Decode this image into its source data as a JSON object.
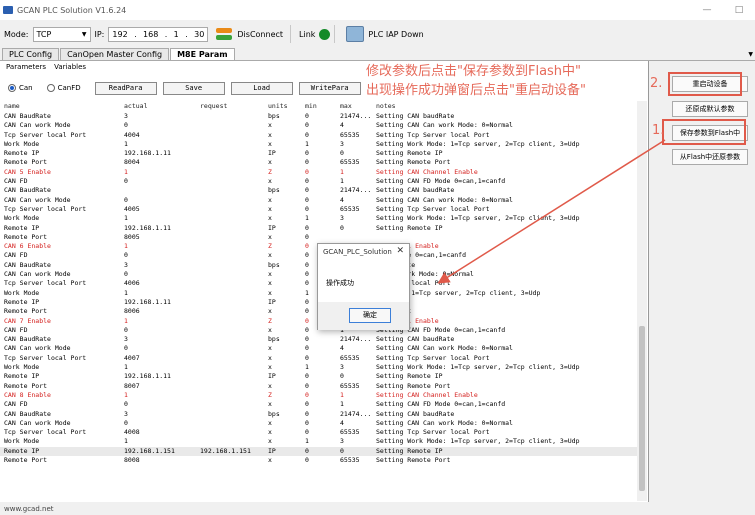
{
  "window": {
    "title": "GCAN PLC Solution V1.6.24",
    "minimize": "—",
    "maximize": "□"
  },
  "toolbar": {
    "mode_label": "Mode:",
    "mode_value": "TCP",
    "ip_label": "IP:",
    "ip": [
      "192",
      "168",
      "1",
      "30"
    ],
    "disconnect_label": "DisConnect",
    "link_label": "Link",
    "link_color": "#138a28",
    "iap_label": "PLC IAP Down"
  },
  "tabs": [
    "PLC Config",
    "CanOpen Master Config",
    "M8E Param"
  ],
  "subtabs": [
    "Parameters",
    "Variables"
  ],
  "controls": {
    "can": "Can",
    "canfd": "CanFD",
    "read": "ReadPara",
    "save": "Save",
    "load": "Load",
    "write": "WritePara"
  },
  "annotations": {
    "line1": "修改参数后点击\"保存参数到Flash中\"",
    "line2": "出现操作成功弹窗后点击\"重启动设备\"",
    "num2": "2.",
    "num1": "1.",
    "color": "#e05a4a"
  },
  "side_buttons": [
    "重启动设备",
    "还原成默认参数",
    "保存参数到Flash中",
    "从Flash中还原参数"
  ],
  "dialog": {
    "title": "GCAN_PLC_Solution",
    "close": "✕",
    "message": "操作成功",
    "ok": "确定"
  },
  "table": {
    "headers": [
      "name",
      "actual",
      "request",
      "units",
      "min",
      "max",
      "notes"
    ],
    "rows": [
      {
        "c": [
          "CAN BaudRate",
          "3",
          "",
          "bps",
          "0",
          "21474...",
          "Setting CAN baudRate"
        ]
      },
      {
        "c": [
          "CAN Can work Mode",
          "0",
          "",
          "x",
          "0",
          "4",
          "Setting CAN Can work Mode: 0=Normal"
        ]
      },
      {
        "c": [
          "Tcp Server local Port",
          "4004",
          "",
          "x",
          "0",
          "65535",
          "Setting Tcp Server local Port"
        ]
      },
      {
        "c": [
          "Work Mode",
          "1",
          "",
          "x",
          "1",
          "3",
          "Setting Work Mode: 1=Tcp server, 2=Tcp client, 3=Udp"
        ]
      },
      {
        "c": [
          "Remote IP",
          "192.168.1.11",
          "",
          "IP",
          "0",
          "0",
          "Setting Remote IP"
        ]
      },
      {
        "c": [
          "Remote Port",
          "8004",
          "",
          "x",
          "0",
          "65535",
          "Setting Remote Port"
        ]
      },
      {
        "c": [
          "CAN 5 Enable",
          "1",
          "",
          "Z",
          "0",
          "1",
          "Setting CAN Channel Enable"
        ],
        "red": true
      },
      {
        "c": [
          "CAN FD",
          "0",
          "",
          "x",
          "0",
          "1",
          "Setting CAN FD Mode 0=can,1=canfd"
        ]
      },
      {
        "c": [
          "CAN BaudRate",
          "",
          "",
          "bps",
          "0",
          "21474...",
          "Setting CAN baudRate"
        ]
      },
      {
        "c": [
          "CAN Can work Mode",
          "0",
          "",
          "x",
          "0",
          "4",
          "Setting CAN Can work Mode: 0=Normal"
        ]
      },
      {
        "c": [
          "Tcp Server local Port",
          "4005",
          "",
          "x",
          "0",
          "65535",
          "Setting Tcp Server local Port"
        ]
      },
      {
        "c": [
          "Work Mode",
          "1",
          "",
          "x",
          "1",
          "3",
          "Setting Work Mode: 1=Tcp server, 2=Tcp client, 3=Udp"
        ]
      },
      {
        "c": [
          "Remote IP",
          "192.168.1.11",
          "",
          "IP",
          "0",
          "0",
          "Setting Remote IP"
        ]
      },
      {
        "c": [
          "Remote Port",
          "8005",
          "",
          "x",
          "0",
          "",
          ""
        ]
      },
      {
        "c": [
          "CAN 6 Enable",
          "1",
          "",
          "Z",
          "0",
          "",
          "N Channel Enable"
        ],
        "red": true
      },
      {
        "c": [
          "CAN FD",
          "0",
          "",
          "x",
          "0",
          "",
          "N FD Mode 0=can,1=canfd"
        ]
      },
      {
        "c": [
          "CAN BaudRate",
          "3",
          "",
          "bps",
          "0",
          "",
          "N baudRate"
        ]
      },
      {
        "c": [
          "CAN Can work Mode",
          "0",
          "",
          "x",
          "0",
          "",
          "N Can work Mode: 0=Normal"
        ]
      },
      {
        "c": [
          "Tcp Server local Port",
          "4006",
          "",
          "x",
          "0",
          "",
          "p Server local Port"
        ]
      },
      {
        "c": [
          "Work Mode",
          "1",
          "",
          "x",
          "1",
          "",
          "rk Mode: 1=Tcp server, 2=Tcp client, 3=Udp"
        ]
      },
      {
        "c": [
          "Remote IP",
          "192.168.1.11",
          "",
          "IP",
          "0",
          "",
          "mote IP"
        ]
      },
      {
        "c": [
          "Remote Port",
          "8006",
          "",
          "x",
          "0",
          "",
          "mote Port"
        ]
      },
      {
        "c": [
          "CAN 7 Enable",
          "1",
          "",
          "Z",
          "0",
          "",
          "N Channel Enable"
        ],
        "red": true
      },
      {
        "c": [
          "CAN FD",
          "0",
          "",
          "x",
          "0",
          "1",
          "Setting CAN FD Mode 0=can,1=canfd"
        ]
      },
      {
        "c": [
          "CAN BaudRate",
          "3",
          "",
          "bps",
          "0",
          "21474...",
          "Setting CAN baudRate"
        ]
      },
      {
        "c": [
          "CAN Can work Mode",
          "0",
          "",
          "x",
          "0",
          "4",
          "Setting CAN Can work Mode: 0=Normal"
        ]
      },
      {
        "c": [
          "Tcp Server local Port",
          "4007",
          "",
          "x",
          "0",
          "65535",
          "Setting Tcp Server local Port"
        ]
      },
      {
        "c": [
          "Work Mode",
          "1",
          "",
          "x",
          "1",
          "3",
          "Setting Work Mode: 1=Tcp server, 2=Tcp client, 3=Udp"
        ]
      },
      {
        "c": [
          "Remote IP",
          "192.168.1.11",
          "",
          "IP",
          "0",
          "0",
          "Setting Remote IP"
        ]
      },
      {
        "c": [
          "Remote Port",
          "8007",
          "",
          "x",
          "0",
          "65535",
          "Setting Remote Port"
        ]
      },
      {
        "c": [
          "CAN 8 Enable",
          "1",
          "",
          "Z",
          "0",
          "1",
          "Setting CAN Channel Enable"
        ],
        "red": true
      },
      {
        "c": [
          "CAN FD",
          "0",
          "",
          "x",
          "0",
          "1",
          "Setting CAN FD Mode 0=can,1=canfd"
        ]
      },
      {
        "c": [
          "CAN BaudRate",
          "3",
          "",
          "bps",
          "0",
          "21474...",
          "Setting CAN baudRate"
        ]
      },
      {
        "c": [
          "CAN Can work Mode",
          "0",
          "",
          "x",
          "0",
          "4",
          "Setting CAN Can work Mode: 0=Normal"
        ]
      },
      {
        "c": [
          "Tcp Server local Port",
          "4008",
          "",
          "x",
          "0",
          "65535",
          "Setting Tcp Server local Port"
        ]
      },
      {
        "c": [
          "Work Mode",
          "1",
          "",
          "x",
          "1",
          "3",
          "Setting Work Mode: 1=Tcp server, 2=Tcp client, 3=Udp"
        ]
      },
      {
        "c": [
          "Remote IP",
          "192.168.1.151",
          "192.168.1.151",
          "IP",
          "0",
          "0",
          "Setting Remote IP"
        ],
        "selected": true
      },
      {
        "c": [
          "Remote Port",
          "8008",
          "",
          "x",
          "0",
          "65535",
          "Setting Remote Port"
        ]
      }
    ]
  },
  "status": "www.gcad.net"
}
